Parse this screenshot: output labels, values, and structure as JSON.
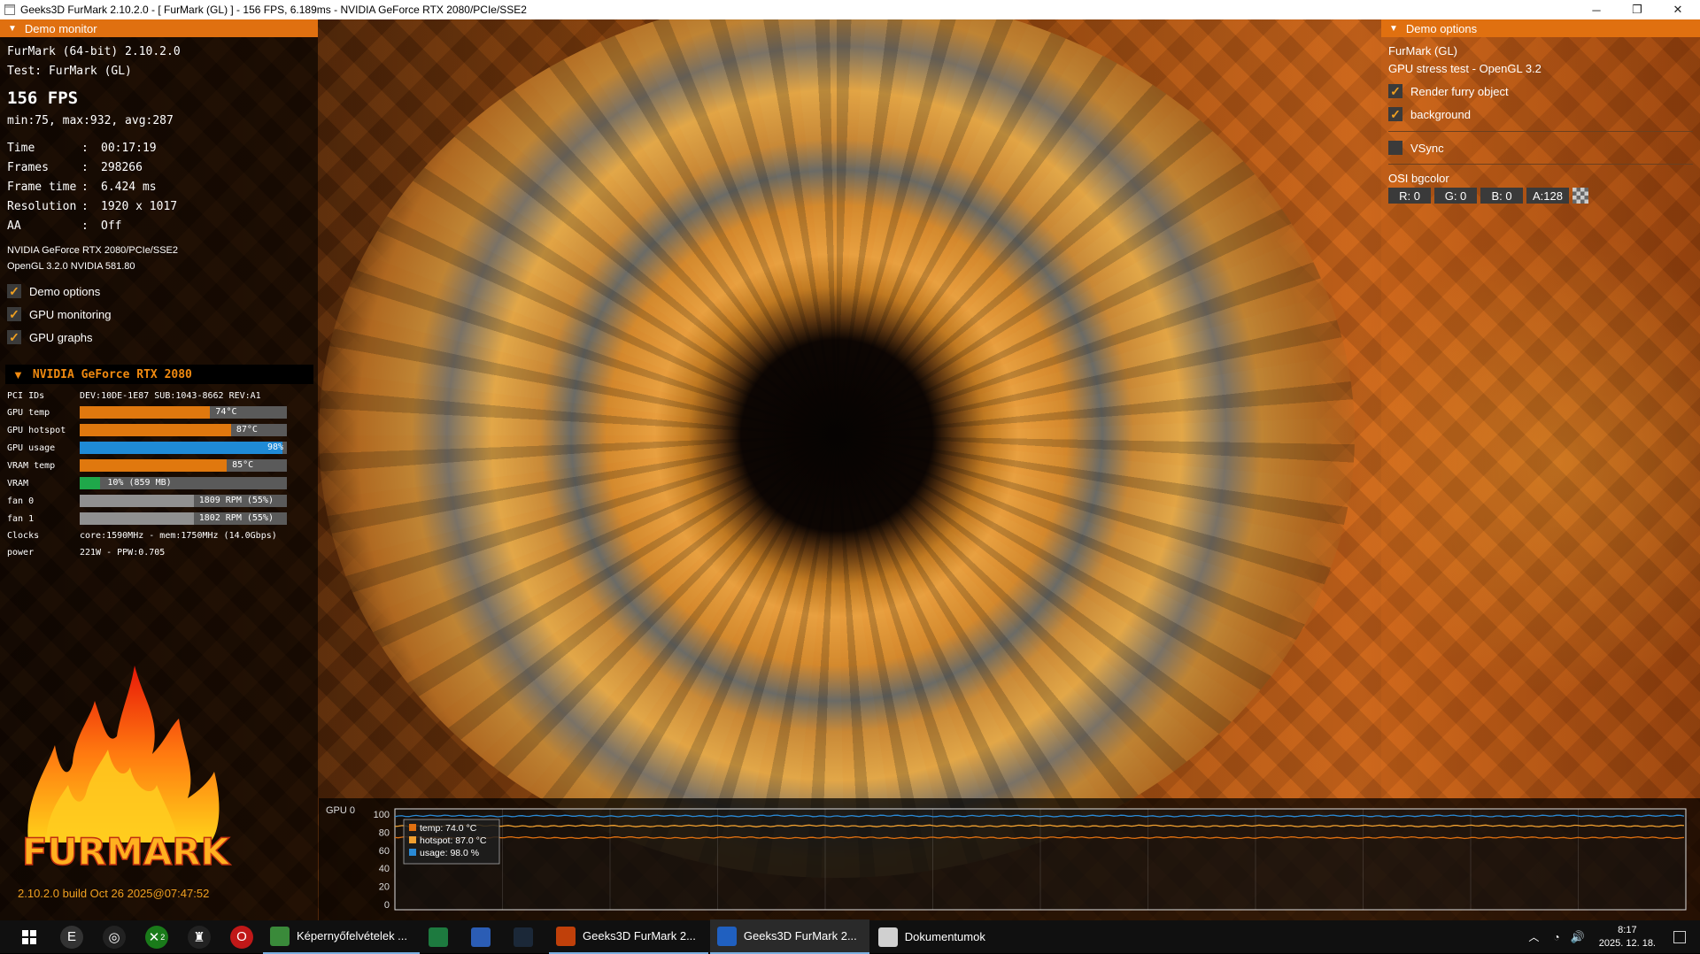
{
  "window": {
    "title": "Geeks3D FurMark 2.10.2.0 - [ FurMark (GL) ] - 156 FPS, 6.189ms - NVIDIA GeForce RTX 2080/PCIe/SSE2",
    "minimize": "─",
    "restore": "❐",
    "close": "✕"
  },
  "demo_monitor": {
    "header": "Demo monitor",
    "app_line": "FurMark (64-bit) 2.10.2.0",
    "test_line": "Test: FurMark (GL)",
    "fps": "156 FPS",
    "minmax": "min:75, max:932, avg:287",
    "stats": [
      {
        "key": "Time",
        "sep": ":",
        "value": "00:17:19"
      },
      {
        "key": "Frames",
        "sep": ":",
        "value": "298266"
      },
      {
        "key": "Frame time",
        "sep": ":",
        "value": "6.424 ms"
      },
      {
        "key": "Resolution",
        "sep": ":",
        "value": "1920 x 1017"
      },
      {
        "key": "AA",
        "sep": ":",
        "value": "Off"
      }
    ],
    "gpu_line1": "NVIDIA GeForce RTX 2080/PCIe/SSE2",
    "gpu_line2": "OpenGL 3.2.0 NVIDIA 581.80",
    "checks": [
      {
        "label": "Demo options",
        "checked": true
      },
      {
        "label": "GPU monitoring",
        "checked": true
      },
      {
        "label": "GPU graphs",
        "checked": true
      }
    ],
    "gpu_section": "NVIDIA GeForce RTX 2080",
    "pci_label": "PCI IDs",
    "pci_value": "DEV:10DE-1E87 SUB:1043-8662 REV:A1",
    "sensors": [
      {
        "label": "GPU temp",
        "value": "74°C",
        "level": 0.63,
        "color": "#e0780e"
      },
      {
        "label": "GPU hotspot",
        "value": "87°C",
        "level": 0.73,
        "color": "#e0780e"
      },
      {
        "label": "GPU usage",
        "value": "98%",
        "level": 0.98,
        "color": "#1f8ad6"
      },
      {
        "label": "VRAM temp",
        "value": "85°C",
        "level": 0.71,
        "color": "#e0780e"
      },
      {
        "label": "VRAM",
        "value": "10% (859 MB)",
        "level": 0.1,
        "color": "#1fa84a"
      },
      {
        "label": "fan 0",
        "value": "1809 RPM (55%)",
        "level": 0.55,
        "color": "#909090"
      },
      {
        "label": "fan 1",
        "value": "1802 RPM (55%)",
        "level": 0.55,
        "color": "#909090"
      }
    ],
    "clocks_label": "Clocks",
    "clocks_value": "core:1590MHz - mem:1750MHz (14.0Gbps)",
    "power_label": "power",
    "power_value": "221W - PPW:0.705",
    "logo_text": "FURMARK",
    "build": "2.10.2.0 build Oct 26 2025@07:47:52"
  },
  "demo_options": {
    "header": "Demo options",
    "name": "FurMark (GL)",
    "desc": "GPU stress test - OpenGL 3.2",
    "checks": [
      {
        "label": "Render furry object",
        "checked": true
      },
      {
        "label": "background",
        "checked": true
      }
    ],
    "vsync_label": "VSync",
    "osi_label": "OSI bgcolor",
    "r": "R: 0",
    "g": "G: 0",
    "b": "B: 0",
    "a": "A:128"
  },
  "chart_data": {
    "type": "line",
    "title": "GPU 0",
    "ylim": [
      0,
      100
    ],
    "yticks": [
      "100",
      "80",
      "60",
      "40",
      "20",
      "0"
    ],
    "legend": [
      "temp: 74.0 °C",
      "hotspot: 87.0 °C",
      "usage: 98.0 %"
    ],
    "series": [
      {
        "name": "temp",
        "color": "#e07010",
        "level": 74
      },
      {
        "name": "hotspot",
        "color": "#f0a030",
        "level": 87
      },
      {
        "name": "usage",
        "color": "#2a8ad6",
        "level": 98
      }
    ]
  },
  "taskbar": {
    "start_icon": "windows-start-icon",
    "pinned": [
      "epic-games-icon",
      "obs-icon",
      "xbox-icon",
      "aorus-icon",
      "opera-icon"
    ],
    "xbox_badge": "2",
    "items": [
      {
        "label": "Képernyőfelvételek ...",
        "icon": "chrome-icon",
        "color": "#3a8a3a"
      },
      {
        "label": "",
        "icon": "excel-icon",
        "color": "#1d7a3f"
      },
      {
        "label": "",
        "icon": "word-icon",
        "color": "#2b5db5"
      },
      {
        "label": "",
        "icon": "steam-icon",
        "color": "#1b2838"
      },
      {
        "label": "Geeks3D FurMark 2...",
        "icon": "furmark-icon",
        "color": "#c0400a"
      },
      {
        "label": "Geeks3D FurMark 2...",
        "icon": "furmark-window-icon",
        "color": "#2060c0"
      },
      {
        "label": "Dokumentumok",
        "icon": "file-explorer-icon",
        "color": "#d0d0d0"
      }
    ],
    "time": "8:17",
    "date": "2025. 12. 18."
  }
}
